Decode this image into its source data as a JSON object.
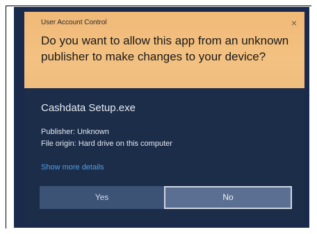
{
  "dialog": {
    "window_title": "User Account Control",
    "close_glyph": "×",
    "question": "Do you want to allow this app from an unknown publisher to make changes to your device?",
    "app_name": "Cashdata Setup.exe",
    "publisher": "Publisher: Unknown",
    "file_origin": "File origin: Hard drive on this computer",
    "show_more_details": "Show more details",
    "yes_label": "Yes",
    "no_label": "No"
  },
  "colors": {
    "header_background": "#f3c181",
    "body_background": "#1c2d4a",
    "link": "#4f9fe6",
    "yes_button": "#3c5376",
    "no_button": "#5a6f91"
  }
}
